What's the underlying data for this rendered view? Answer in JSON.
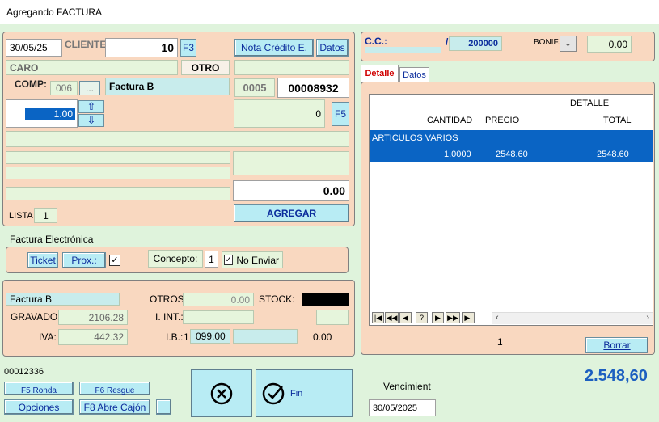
{
  "window": {
    "title": "Agregando FACTURA"
  },
  "left": {
    "date": "30/05/25",
    "cliente_label": "CLIENTE:",
    "cliente_value": "10",
    "f3_label": "F3",
    "nota_credito_label": "Nota Crédito E.",
    "datos_label": "Datos",
    "client_name": "CARO",
    "otro_label": "OTRO",
    "comp_label": "COMP:",
    "comp_code": "006",
    "comp_btn": "...",
    "comp_type": "Factura B",
    "punto_venta": "0005",
    "numero": "00008932",
    "cantidad": "1.00",
    "f5_value": "0",
    "f5_label": "F5",
    "total_line": "0.00",
    "lista_label": "LISTA",
    "lista_value": "1",
    "agregar_label": "AGREGAR"
  },
  "fe": {
    "title": "Factura Electrónica",
    "ticket_label": "Ticket",
    "prox_label": "Prox.:",
    "concepto_label": "Concepto:",
    "concepto_value": "1",
    "no_enviar_label": "No Enviar"
  },
  "totals": {
    "type": "Factura B",
    "otros_label": "OTROS:",
    "otros_value": "0.00",
    "stock_label": "STOCK:",
    "gravado_label": "GRAVADO:",
    "gravado_value": "2106.28",
    "iint_label": "I. INT.:",
    "iva_label": "IVA:",
    "iva_value": "442.32",
    "ib_label": "I.B.:",
    "ib_code": "1",
    "ib_value": "099.00",
    "ib_extra": "0.00"
  },
  "right": {
    "cc_label": "C.C.:",
    "cc_slash": "/",
    "cc_value": "200000",
    "bonif_label": "BONIF.:",
    "bonif_value": "0.00",
    "tabs": [
      {
        "label": "Detalle",
        "active": true
      },
      {
        "label": "Datos",
        "active": false
      }
    ],
    "grid": {
      "group_header": "DETALLE",
      "headers": [
        "CANTIDAD",
        "PRECIO",
        "TOTAL"
      ],
      "group_row": "ARTICULOS VARIOS",
      "rows": [
        {
          "cantidad": "1.0000",
          "precio": "2548.60",
          "total": "2548.60"
        }
      ],
      "nav": [
        "|◀",
        "◀◀",
        "◀",
        "?",
        "▶",
        "▶▶",
        "▶|"
      ]
    },
    "count": "1",
    "borrar_label": "Borrar"
  },
  "bottom": {
    "code": "00012336",
    "btn_a": "F5 Ronda",
    "btn_b": "F6 Resgue",
    "opciones_label": "Opciones",
    "f8_label": "F8 Abre Cajón",
    "fin_label": "Fin",
    "vencimiento_label": "Vencimient",
    "vencimiento_value": "30/05/2025",
    "grand_total": "2.548,60"
  }
}
